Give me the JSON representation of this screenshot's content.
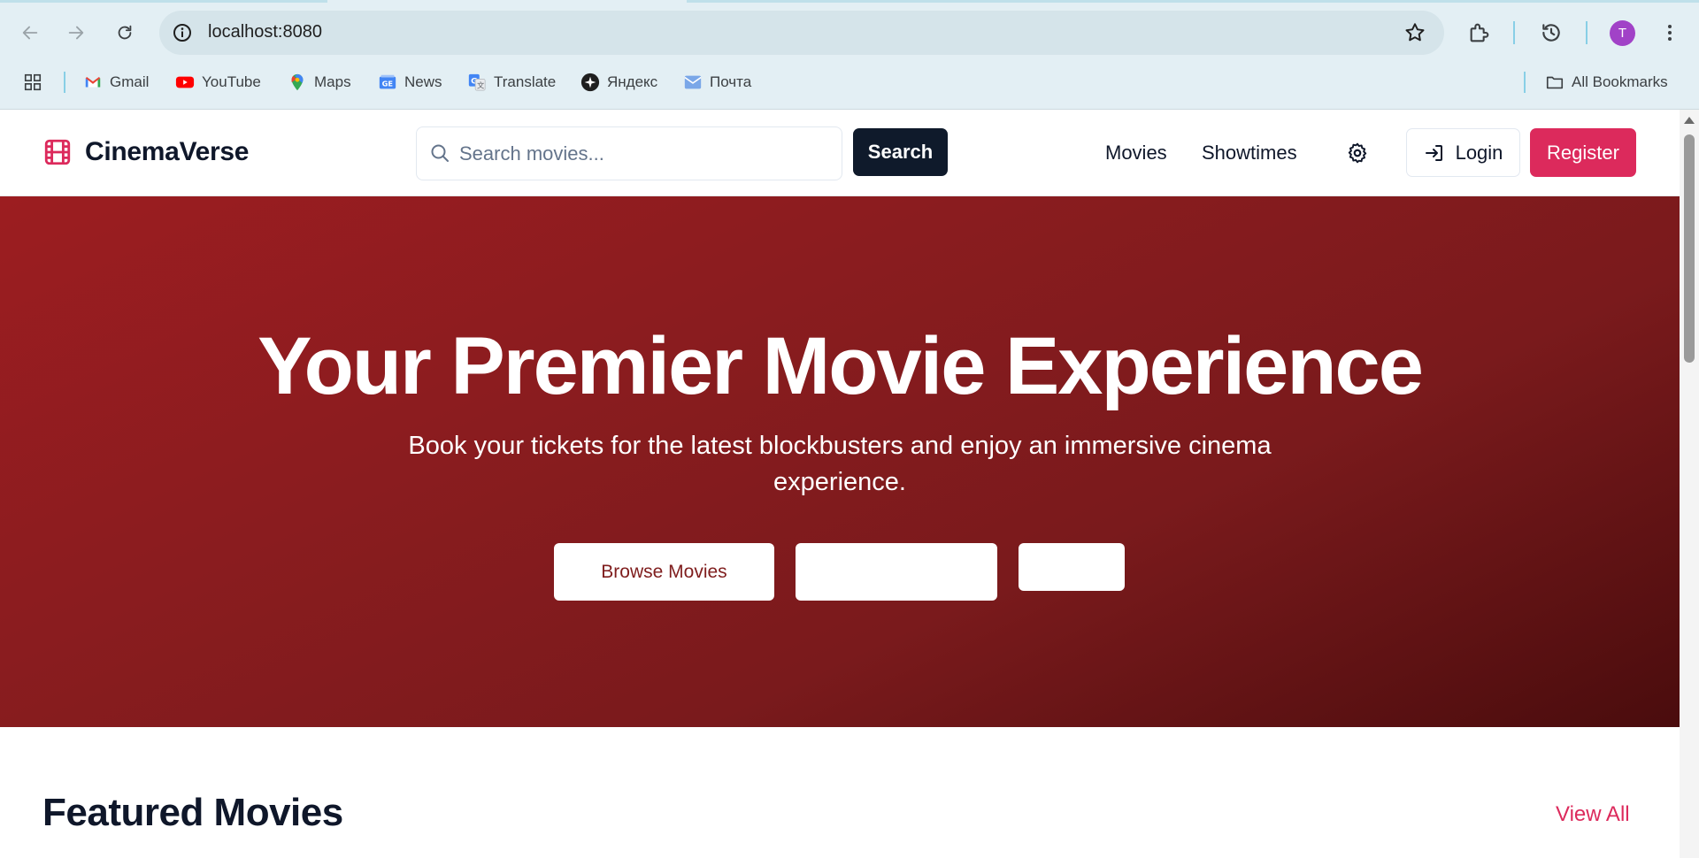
{
  "browser": {
    "url": "localhost:8080",
    "profile_initial": "T",
    "bookmarks": [
      {
        "label": "Gmail",
        "icon": "gmail-icon"
      },
      {
        "label": "YouTube",
        "icon": "youtube-icon"
      },
      {
        "label": "Maps",
        "icon": "maps-icon"
      },
      {
        "label": "News",
        "icon": "news-icon"
      },
      {
        "label": "Translate",
        "icon": "translate-icon"
      },
      {
        "label": "Яндекс",
        "icon": "yandex-icon"
      },
      {
        "label": "Почта",
        "icon": "mail-icon"
      }
    ],
    "all_bookmarks": "All Bookmarks"
  },
  "site": {
    "brand": "CinemaVerse",
    "brand_color": "#dc2a5c",
    "search": {
      "placeholder": "Search movies...",
      "button": "Search"
    },
    "nav": {
      "movies": "Movies",
      "showtimes": "Showtimes"
    },
    "login": "Login",
    "register": "Register"
  },
  "hero": {
    "title": "Your Premier Movie Experience",
    "subtitle": "Book your tickets for the latest blockbusters and enjoy an immersive cinema experience.",
    "primary_button": "Browse Movies",
    "secondary_button": "",
    "tertiary_button": ""
  },
  "featured": {
    "title": "Featured Movies",
    "view_all": "View All"
  }
}
